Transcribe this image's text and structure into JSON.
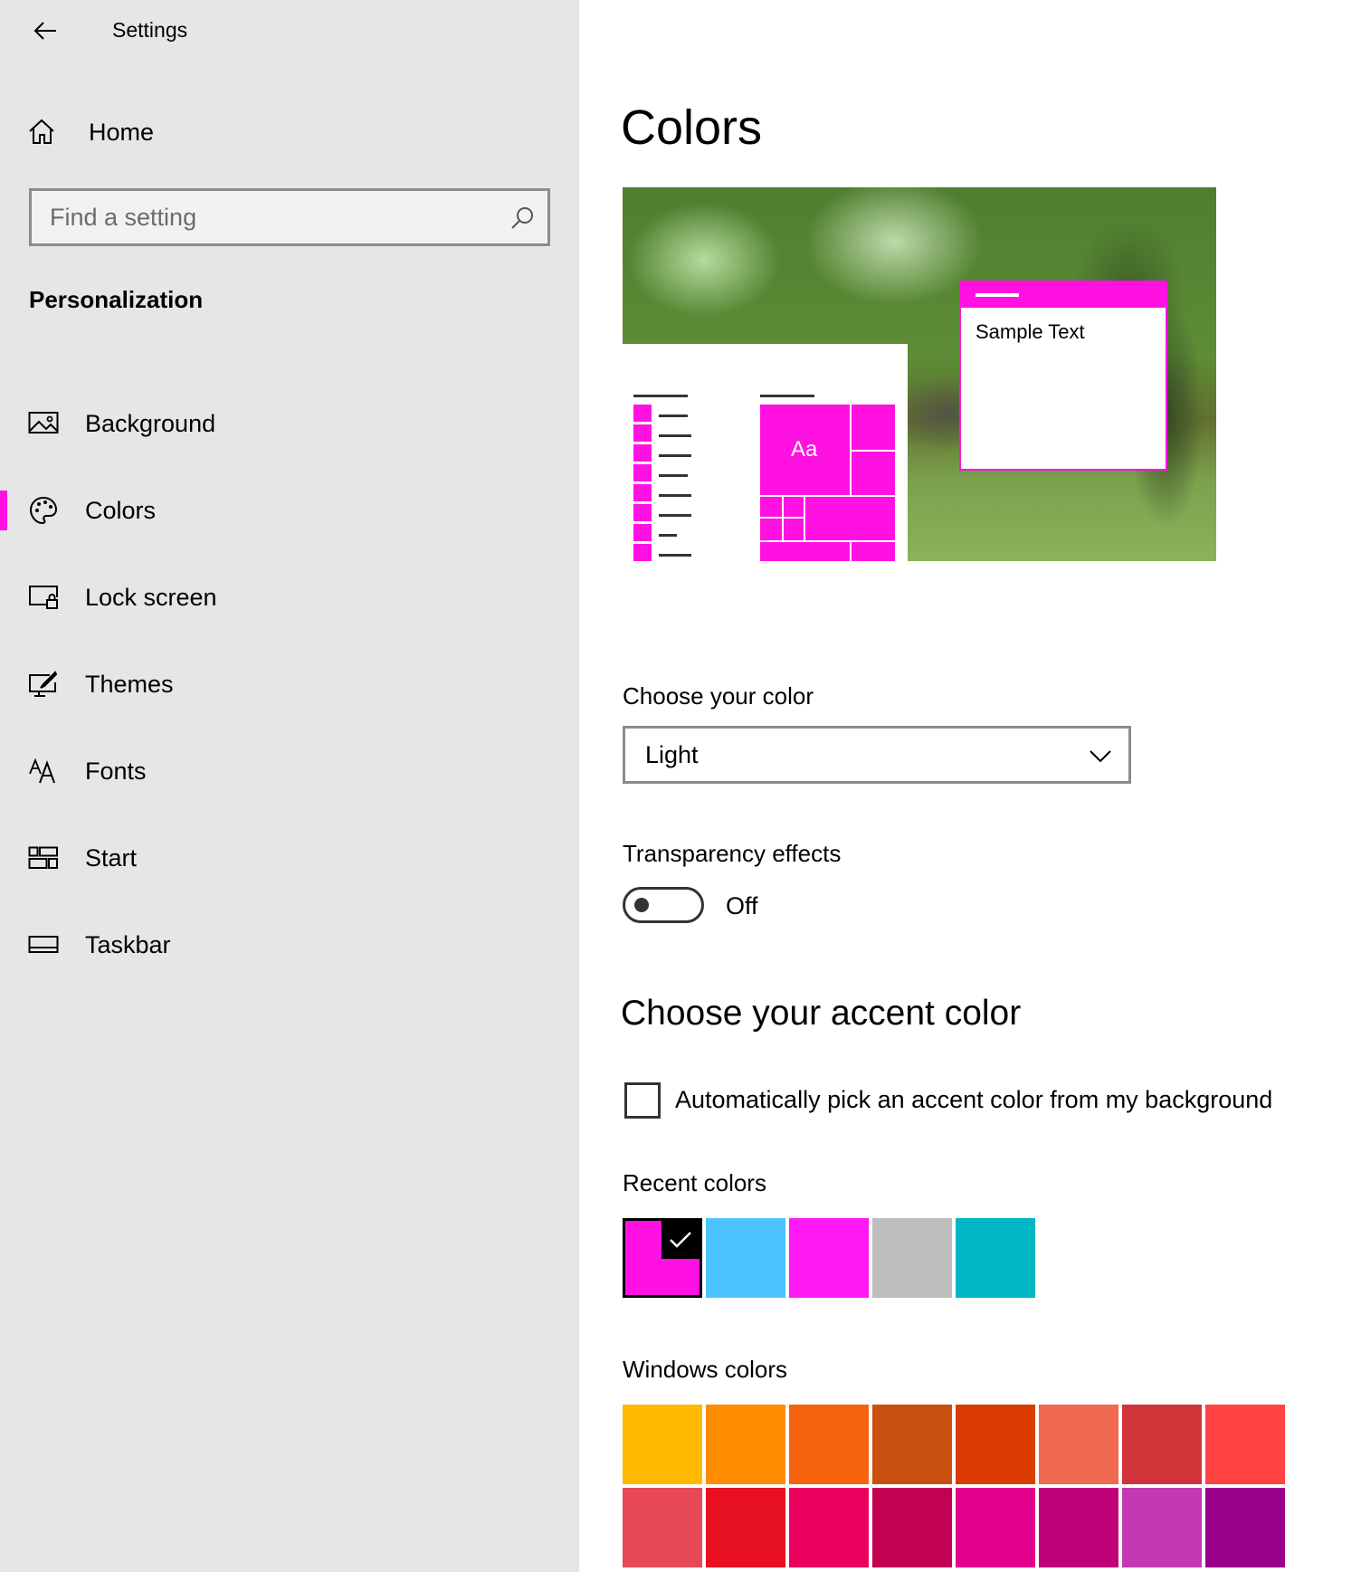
{
  "window": {
    "title": "Settings"
  },
  "sidebar": {
    "home_label": "Home",
    "search_placeholder": "Find a setting",
    "section_title": "Personalization",
    "items": [
      {
        "label": "Background",
        "icon": "picture-icon"
      },
      {
        "label": "Colors",
        "icon": "palette-icon",
        "active": true
      },
      {
        "label": "Lock screen",
        "icon": "lock-screen-icon"
      },
      {
        "label": "Themes",
        "icon": "themes-icon"
      },
      {
        "label": "Fonts",
        "icon": "fonts-icon"
      },
      {
        "label": "Start",
        "icon": "start-icon"
      },
      {
        "label": "Taskbar",
        "icon": "taskbar-icon"
      }
    ]
  },
  "main": {
    "title": "Colors",
    "preview": {
      "sample_text": "Sample Text",
      "tile_text": "Aa"
    },
    "choose_color": {
      "label": "Choose your color",
      "value": "Light"
    },
    "transparency": {
      "label": "Transparency effects",
      "state": "Off"
    },
    "accent_heading": "Choose your accent color",
    "auto_pick": {
      "label": "Automatically pick an accent color from my background",
      "checked": false
    },
    "recent_colors": {
      "label": "Recent colors",
      "colors": [
        "#ff11e2",
        "#4cc2ff",
        "#ff19f5",
        "#bebebe",
        "#00b7c3"
      ],
      "selected_index": 0
    },
    "windows_colors": {
      "label": "Windows colors",
      "rows": [
        [
          "#ffb900",
          "#ff8c00",
          "#f7630c",
          "#ca5010",
          "#da3b01",
          "#ef6950",
          "#d13438",
          "#ff4343"
        ],
        [
          "#e74856",
          "#e81123",
          "#ea005e",
          "#c30052",
          "#e3008c",
          "#bf0077",
          "#c239b3",
          "#9a0089"
        ]
      ]
    }
  },
  "colors": {
    "accent": "#ff11e2",
    "sidebar_bg": "#e6e6e6"
  }
}
